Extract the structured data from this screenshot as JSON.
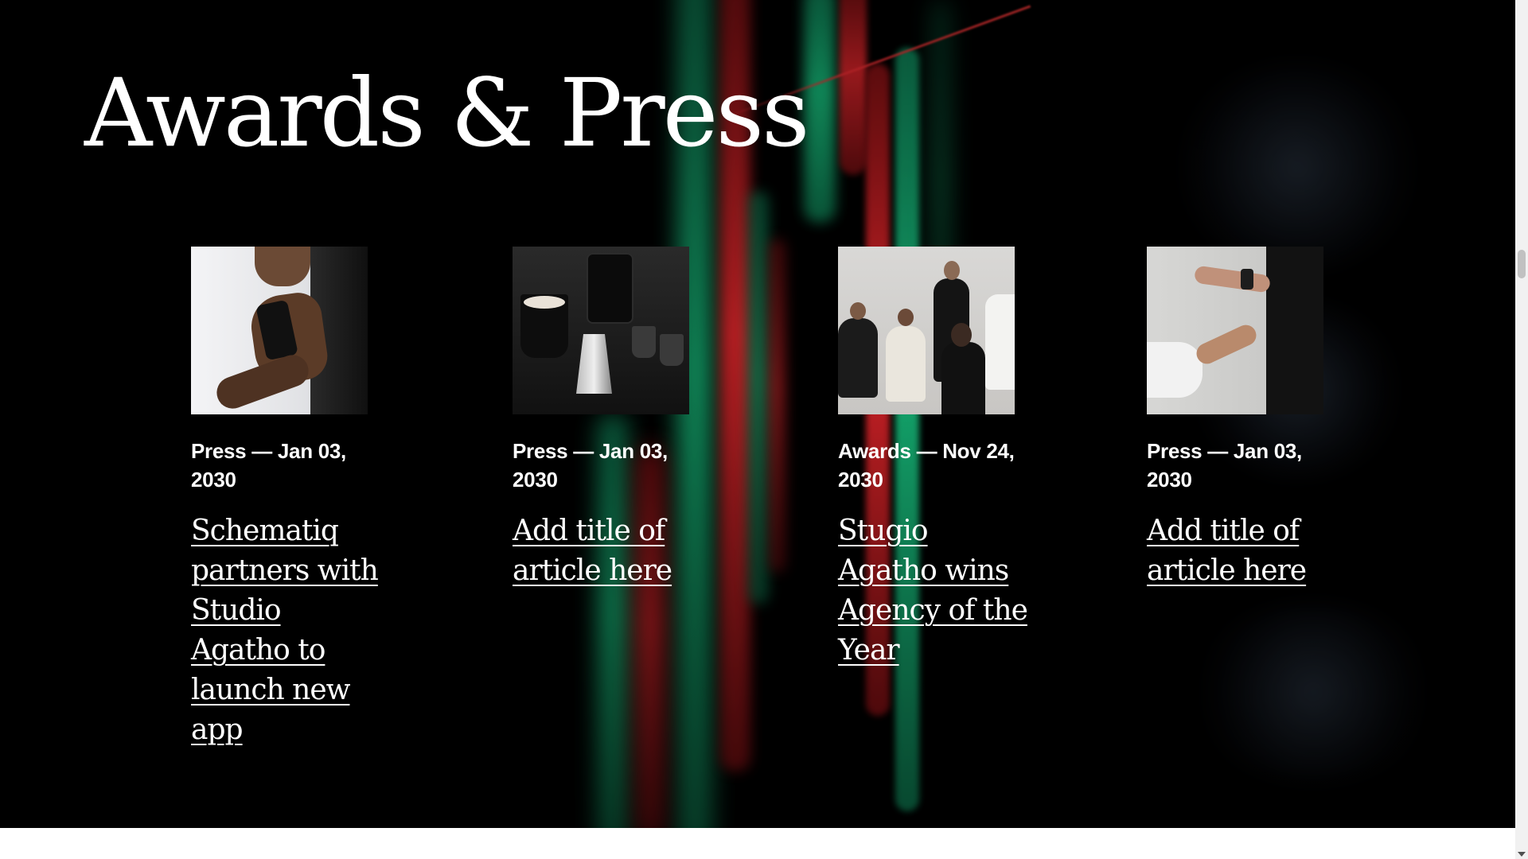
{
  "section": {
    "title": "Awards & Press"
  },
  "articles": [
    {
      "meta": "Press — Jan 03, 2030",
      "title": "Schematiq partners with Studio Agatho to launch new app",
      "image": "woman-holding-phone-photo"
    },
    {
      "meta": "Press — Jan 03, 2030",
      "title": "Add title of article here",
      "image": "black-coffee-cups-photo"
    },
    {
      "meta": "Awards — Nov 24, 2030",
      "title": "Stugio Agatho wins Agency of the Year",
      "image": "team-group-photo"
    },
    {
      "meta": "Press — Jan 03, 2030",
      "title": "Add title of article here",
      "image": "hands-with-watch-photo"
    }
  ],
  "colors": {
    "background": "#000000",
    "text": "#ffffff",
    "accent_green": "#16b878",
    "accent_red": "#e3262b"
  }
}
